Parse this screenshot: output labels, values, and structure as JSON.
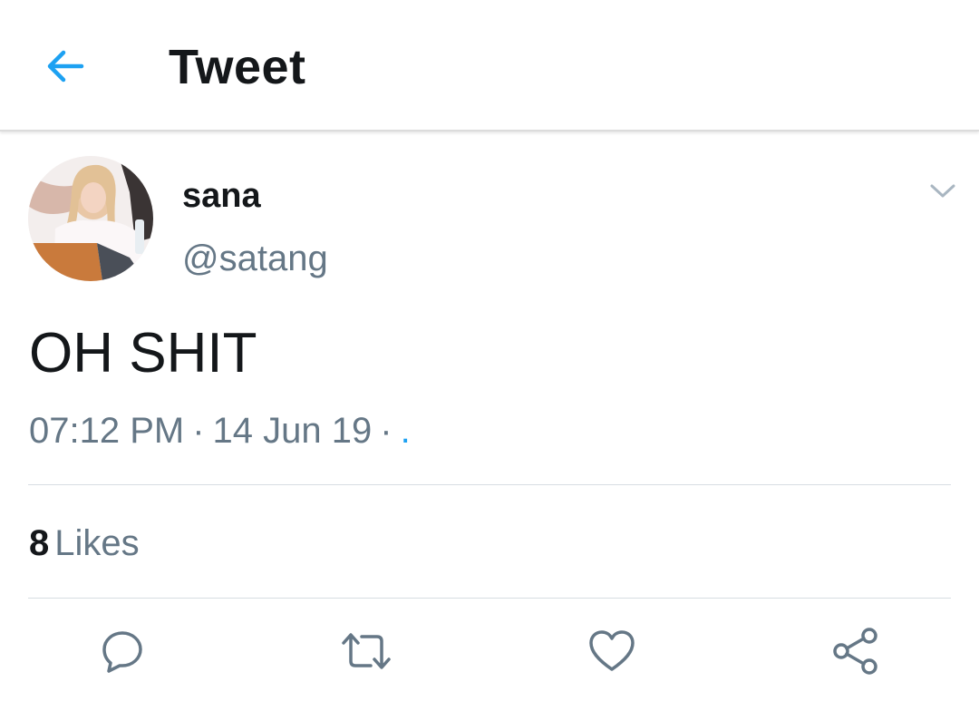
{
  "header": {
    "title": "Tweet",
    "back_icon": "arrow-left-icon"
  },
  "tweet": {
    "author": {
      "display_name": "sana",
      "handle": "@satang"
    },
    "text": "OH SHIT",
    "time": "07:12 PM",
    "date": "14 Jun 19",
    "separator": "·",
    "source": "."
  },
  "stats": {
    "likes_count": "8",
    "likes_label": "Likes"
  },
  "actions": [
    {
      "name": "reply",
      "icon": "reply-icon"
    },
    {
      "name": "retweet",
      "icon": "retweet-icon"
    },
    {
      "name": "like",
      "icon": "heart-icon"
    },
    {
      "name": "share",
      "icon": "share-icon"
    }
  ],
  "colors": {
    "accent": "#1da1f2",
    "text": "#14171a",
    "muted": "#657786",
    "divider": "#d7dde2"
  }
}
